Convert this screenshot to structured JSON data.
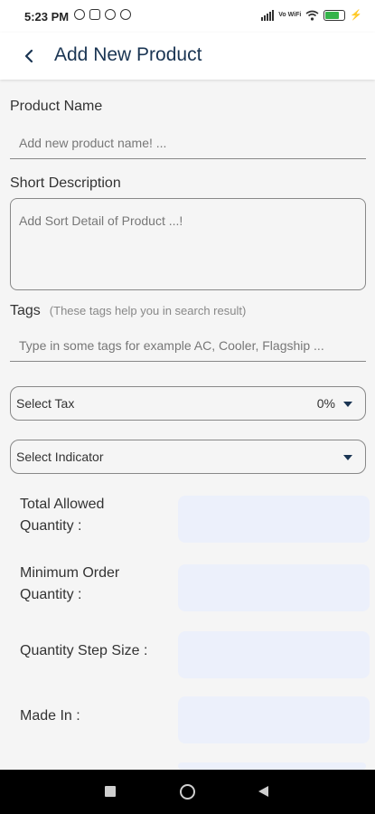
{
  "status_bar": {
    "time": "5:23 PM",
    "left_icons": [
      "alarm-icon",
      "instagram-icon",
      "blocked-icon",
      "blocked-icon"
    ],
    "network_label": "Vo WiFi",
    "battery_color": "#35b34a"
  },
  "header": {
    "back_icon": "chevron-left-icon",
    "title": "Add New Product",
    "title_color": "#1a3553"
  },
  "form": {
    "product_name": {
      "label": "Product Name",
      "placeholder": "Add new product name! ..."
    },
    "short_description": {
      "label": "Short Description",
      "placeholder": "Add Sort Detail of Product ...!"
    },
    "tags": {
      "label": "Tags",
      "hint": "(These tags help you in search result)",
      "placeholder": "Type in some tags for example AC, Cooler, Flagship ..."
    },
    "tax": {
      "label": "Select Tax",
      "value": "0%"
    },
    "indicator": {
      "label": "Select Indicator",
      "value": ""
    },
    "total_allowed_quantity": {
      "label_line1": "Total Allowed",
      "label_line2": "Quantity :"
    },
    "minimum_order_quantity": {
      "label_line1": "Minimum Order",
      "label_line2": "Quantity :"
    },
    "quantity_step_size": {
      "label": "Quantity Step Size :"
    },
    "made_in": {
      "label": "Made In :"
    }
  },
  "nav_bar": {
    "buttons": [
      "recents-icon",
      "home-icon",
      "back-icon"
    ]
  },
  "colors": {
    "accent": "#1a3553",
    "field_fill": "#ecf0fb",
    "background": "#f5f5f5"
  }
}
